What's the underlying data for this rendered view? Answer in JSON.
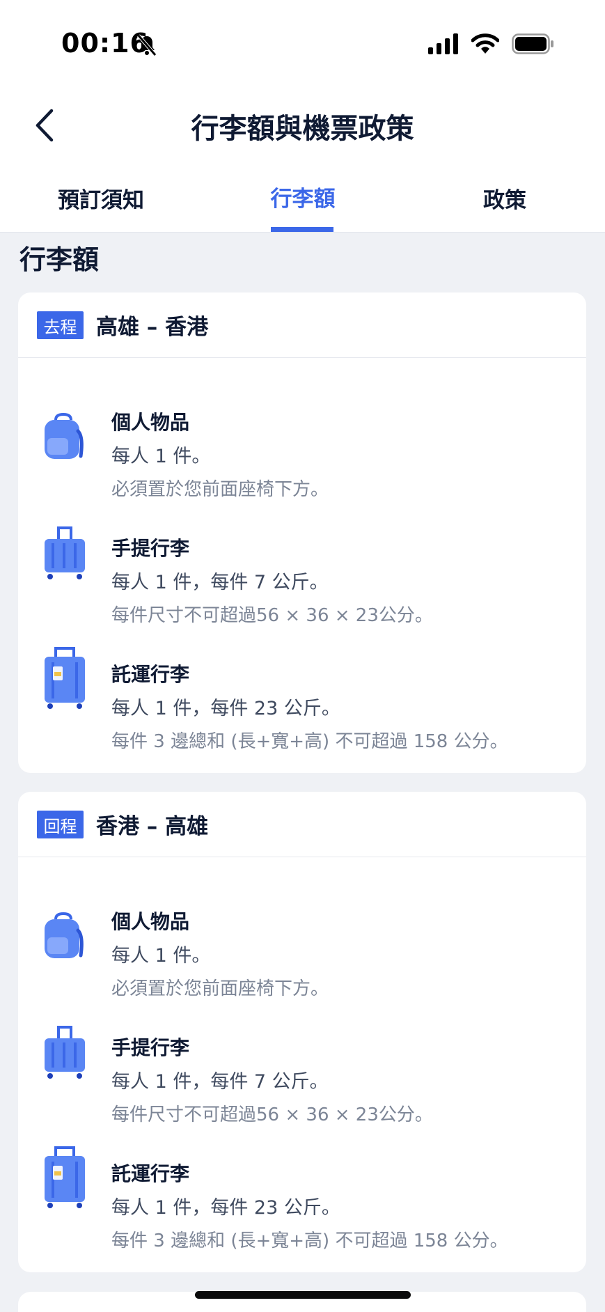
{
  "status": {
    "time": "00:16"
  },
  "header": {
    "title": "行李額與機票政策"
  },
  "tabs": [
    {
      "label": "預訂須知",
      "active": false
    },
    {
      "label": "行李額",
      "active": true
    },
    {
      "label": "政策",
      "active": false
    }
  ],
  "section": {
    "heading": "行李額"
  },
  "trips": [
    {
      "badge": "去程",
      "route": "高雄 – 香港",
      "items": [
        {
          "icon": "backpack-icon",
          "name": "個人物品",
          "line1": "每人 1 件。",
          "line2": "必須置於您前面座椅下方。"
        },
        {
          "icon": "carry-on-suitcase-icon",
          "name": "手提行李",
          "line1": "每人 1 件，每件 7 公斤。",
          "line2": "每件尺寸不可超過56 × 36 × 23公分。"
        },
        {
          "icon": "checked-suitcase-icon",
          "name": "託運行李",
          "line1": "每人 1 件，每件 23 公斤。",
          "line2": "每件 3 邊總和 (長+寬+高) 不可超過 158 公分。"
        }
      ]
    },
    {
      "badge": "回程",
      "route": "香港 – 高雄",
      "items": [
        {
          "icon": "backpack-icon",
          "name": "個人物品",
          "line1": "每人 1 件。",
          "line2": "必須置於您前面座椅下方。"
        },
        {
          "icon": "carry-on-suitcase-icon",
          "name": "手提行李",
          "line1": "每人 1 件，每件 7 公斤。",
          "line2": "每件尺寸不可超過56 × 36 × 23公分。"
        },
        {
          "icon": "checked-suitcase-icon",
          "name": "託運行李",
          "line1": "每人 1 件，每件 23 公斤。",
          "line2": "每件 3 邊總和 (長+寬+高) 不可超過 158 公分。"
        }
      ]
    }
  ],
  "colors": {
    "accent": "#3b67e8",
    "text": "#0f1a33",
    "background": "#eff1f5"
  }
}
